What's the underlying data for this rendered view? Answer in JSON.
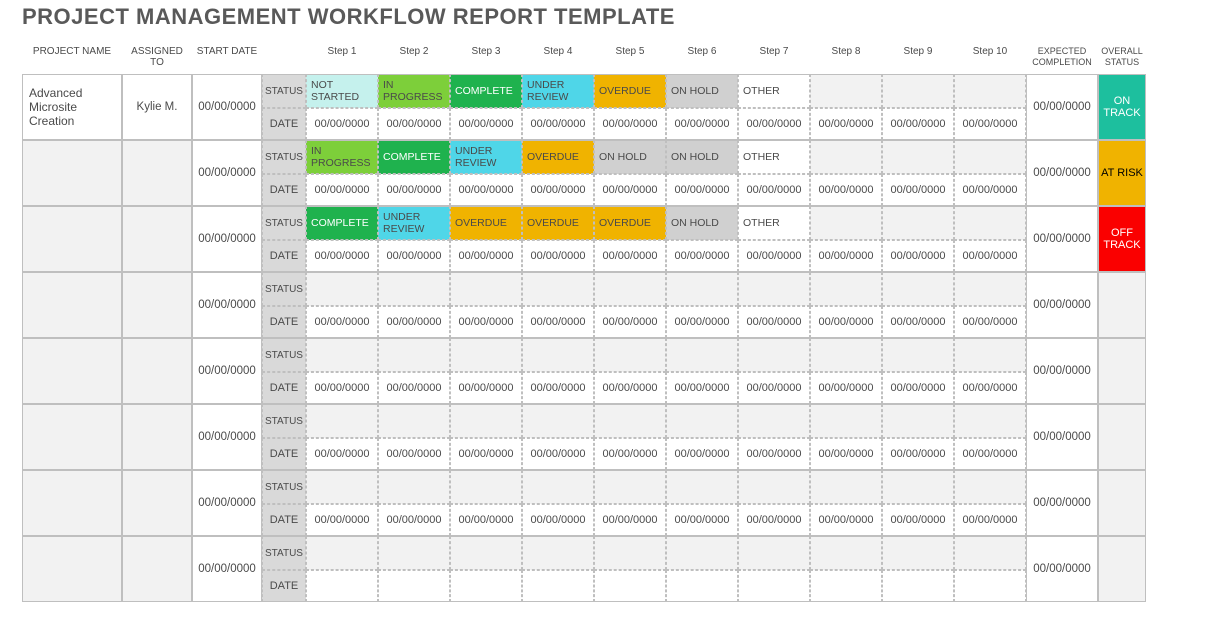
{
  "title": "PROJECT MANAGEMENT WORKFLOW REPORT TEMPLATE",
  "headers": {
    "project_name": "PROJECT NAME",
    "assigned_to": "ASSIGNED TO",
    "start_date": "START DATE",
    "steps": [
      "Step 1",
      "Step 2",
      "Step 3",
      "Step 4",
      "Step 5",
      "Step 6",
      "Step 7",
      "Step 8",
      "Step 9",
      "Step 10"
    ],
    "expected_completion": "EXPECTED COMPLETION",
    "overall_status": "OVERALL STATUS"
  },
  "sublabels": {
    "status": "STATUS",
    "date": "DATE"
  },
  "status_labels": {
    "notstarted": "NOT STARTED",
    "inprogress": "IN PROGRESS",
    "complete": "COMPLETE",
    "underreview": "UNDER REVIEW",
    "overdue": "OVERDUE",
    "onhold": "ON HOLD",
    "other": "OTHER"
  },
  "overall_labels": {
    "ontrack": "ON TRACK",
    "atrisk": "AT RISK",
    "offtrack": "OFF TRACK"
  },
  "placeholder_date": "00/00/0000",
  "rows": [
    {
      "project_name": "Advanced Microsite Creation",
      "assigned_to": "Kylie M.",
      "start_date": "00/00/0000",
      "expected": "00/00/0000",
      "overall": "ontrack",
      "statuses": [
        "notstarted",
        "inprogress",
        "complete",
        "underreview",
        "overdue",
        "onhold",
        "other",
        "",
        "",
        ""
      ],
      "dates": [
        "00/00/0000",
        "00/00/0000",
        "00/00/0000",
        "00/00/0000",
        "00/00/0000",
        "00/00/0000",
        "00/00/0000",
        "00/00/0000",
        "00/00/0000",
        "00/00/0000"
      ]
    },
    {
      "project_name": "",
      "assigned_to": "",
      "start_date": "00/00/0000",
      "expected": "00/00/0000",
      "overall": "atrisk",
      "statuses": [
        "inprogress",
        "complete",
        "underreview",
        "overdue",
        "onhold",
        "onhold",
        "other",
        "",
        "",
        ""
      ],
      "dates": [
        "00/00/0000",
        "00/00/0000",
        "00/00/0000",
        "00/00/0000",
        "00/00/0000",
        "00/00/0000",
        "00/00/0000",
        "00/00/0000",
        "00/00/0000",
        "00/00/0000"
      ]
    },
    {
      "project_name": "",
      "assigned_to": "",
      "start_date": "00/00/0000",
      "expected": "00/00/0000",
      "overall": "offtrack",
      "statuses": [
        "complete",
        "underreview",
        "overdue",
        "overdue",
        "overdue",
        "onhold",
        "other",
        "",
        "",
        ""
      ],
      "dates": [
        "00/00/0000",
        "00/00/0000",
        "00/00/0000",
        "00/00/0000",
        "00/00/0000",
        "00/00/0000",
        "00/00/0000",
        "00/00/0000",
        "00/00/0000",
        "00/00/0000"
      ]
    },
    {
      "project_name": "",
      "assigned_to": "",
      "start_date": "00/00/0000",
      "expected": "00/00/0000",
      "overall": "",
      "statuses": [
        "",
        "",
        "",
        "",
        "",
        "",
        "",
        "",
        "",
        ""
      ],
      "dates": [
        "00/00/0000",
        "00/00/0000",
        "00/00/0000",
        "00/00/0000",
        "00/00/0000",
        "00/00/0000",
        "00/00/0000",
        "00/00/0000",
        "00/00/0000",
        "00/00/0000"
      ]
    },
    {
      "project_name": "",
      "assigned_to": "",
      "start_date": "00/00/0000",
      "expected": "00/00/0000",
      "overall": "",
      "statuses": [
        "",
        "",
        "",
        "",
        "",
        "",
        "",
        "",
        "",
        ""
      ],
      "dates": [
        "00/00/0000",
        "00/00/0000",
        "00/00/0000",
        "00/00/0000",
        "00/00/0000",
        "00/00/0000",
        "00/00/0000",
        "00/00/0000",
        "00/00/0000",
        "00/00/0000"
      ]
    },
    {
      "project_name": "",
      "assigned_to": "",
      "start_date": "00/00/0000",
      "expected": "00/00/0000",
      "overall": "",
      "statuses": [
        "",
        "",
        "",
        "",
        "",
        "",
        "",
        "",
        "",
        ""
      ],
      "dates": [
        "00/00/0000",
        "00/00/0000",
        "00/00/0000",
        "00/00/0000",
        "00/00/0000",
        "00/00/0000",
        "00/00/0000",
        "00/00/0000",
        "00/00/0000",
        "00/00/0000"
      ]
    },
    {
      "project_name": "",
      "assigned_to": "",
      "start_date": "00/00/0000",
      "expected": "00/00/0000",
      "overall": "",
      "statuses": [
        "",
        "",
        "",
        "",
        "",
        "",
        "",
        "",
        "",
        ""
      ],
      "dates": [
        "00/00/0000",
        "00/00/0000",
        "00/00/0000",
        "00/00/0000",
        "00/00/0000",
        "00/00/0000",
        "00/00/0000",
        "00/00/0000",
        "00/00/0000",
        "00/00/0000"
      ]
    },
    {
      "project_name": "",
      "assigned_to": "",
      "start_date": "00/00/0000",
      "expected": "00/00/0000",
      "overall": "",
      "statuses": [
        "",
        "",
        "",
        "",
        "",
        "",
        "",
        "",
        "",
        ""
      ],
      "dates": [
        "",
        "",
        "",
        "",
        "",
        "",
        "",
        "",
        "",
        ""
      ]
    }
  ]
}
